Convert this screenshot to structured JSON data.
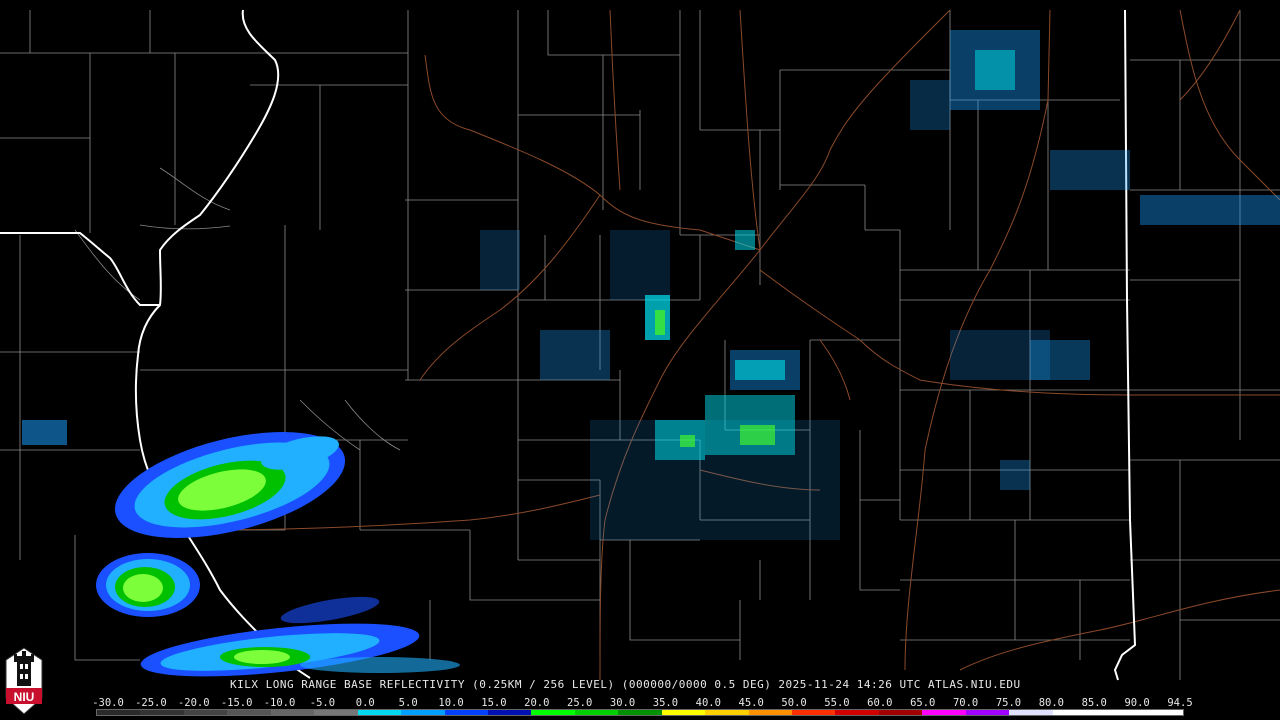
{
  "header": {
    "caption": "KILX LONG RANGE BASE REFLECTIVITY (0.25KM / 256 LEVEL) (000000/0000 0.5 DEG) 2025-11-24 14:26 UTC  ATLAS.NIU.EDU"
  },
  "logo": {
    "text": "NIU",
    "icon": "university-tower-icon",
    "color": "#c8102e"
  },
  "scale": {
    "labels": [
      "-30.0",
      "-25.0",
      "-20.0",
      "-15.0",
      "-10.0",
      "-5.0",
      "0.0",
      "5.0",
      "10.0",
      "15.0",
      "20.0",
      "25.0",
      "30.0",
      "35.0",
      "40.0",
      "45.0",
      "50.0",
      "55.0",
      "60.0",
      "65.0",
      "70.0",
      "75.0",
      "80.0",
      "85.0",
      "90.0",
      "94.5"
    ],
    "colors": [
      "#2a2a2a",
      "#333333",
      "#444444",
      "#555555",
      "#666666",
      "#777777",
      "#00d8f0",
      "#00a0ff",
      "#0040ff",
      "#0010b0",
      "#00ff00",
      "#00d000",
      "#009000",
      "#ffff00",
      "#ffd000",
      "#ff9000",
      "#ff3000",
      "#d00000",
      "#a00000",
      "#ff00ff",
      "#a000ff",
      "#e0e0ff",
      "#ffffff",
      "#ffffff",
      "#ffffff"
    ]
  }
}
